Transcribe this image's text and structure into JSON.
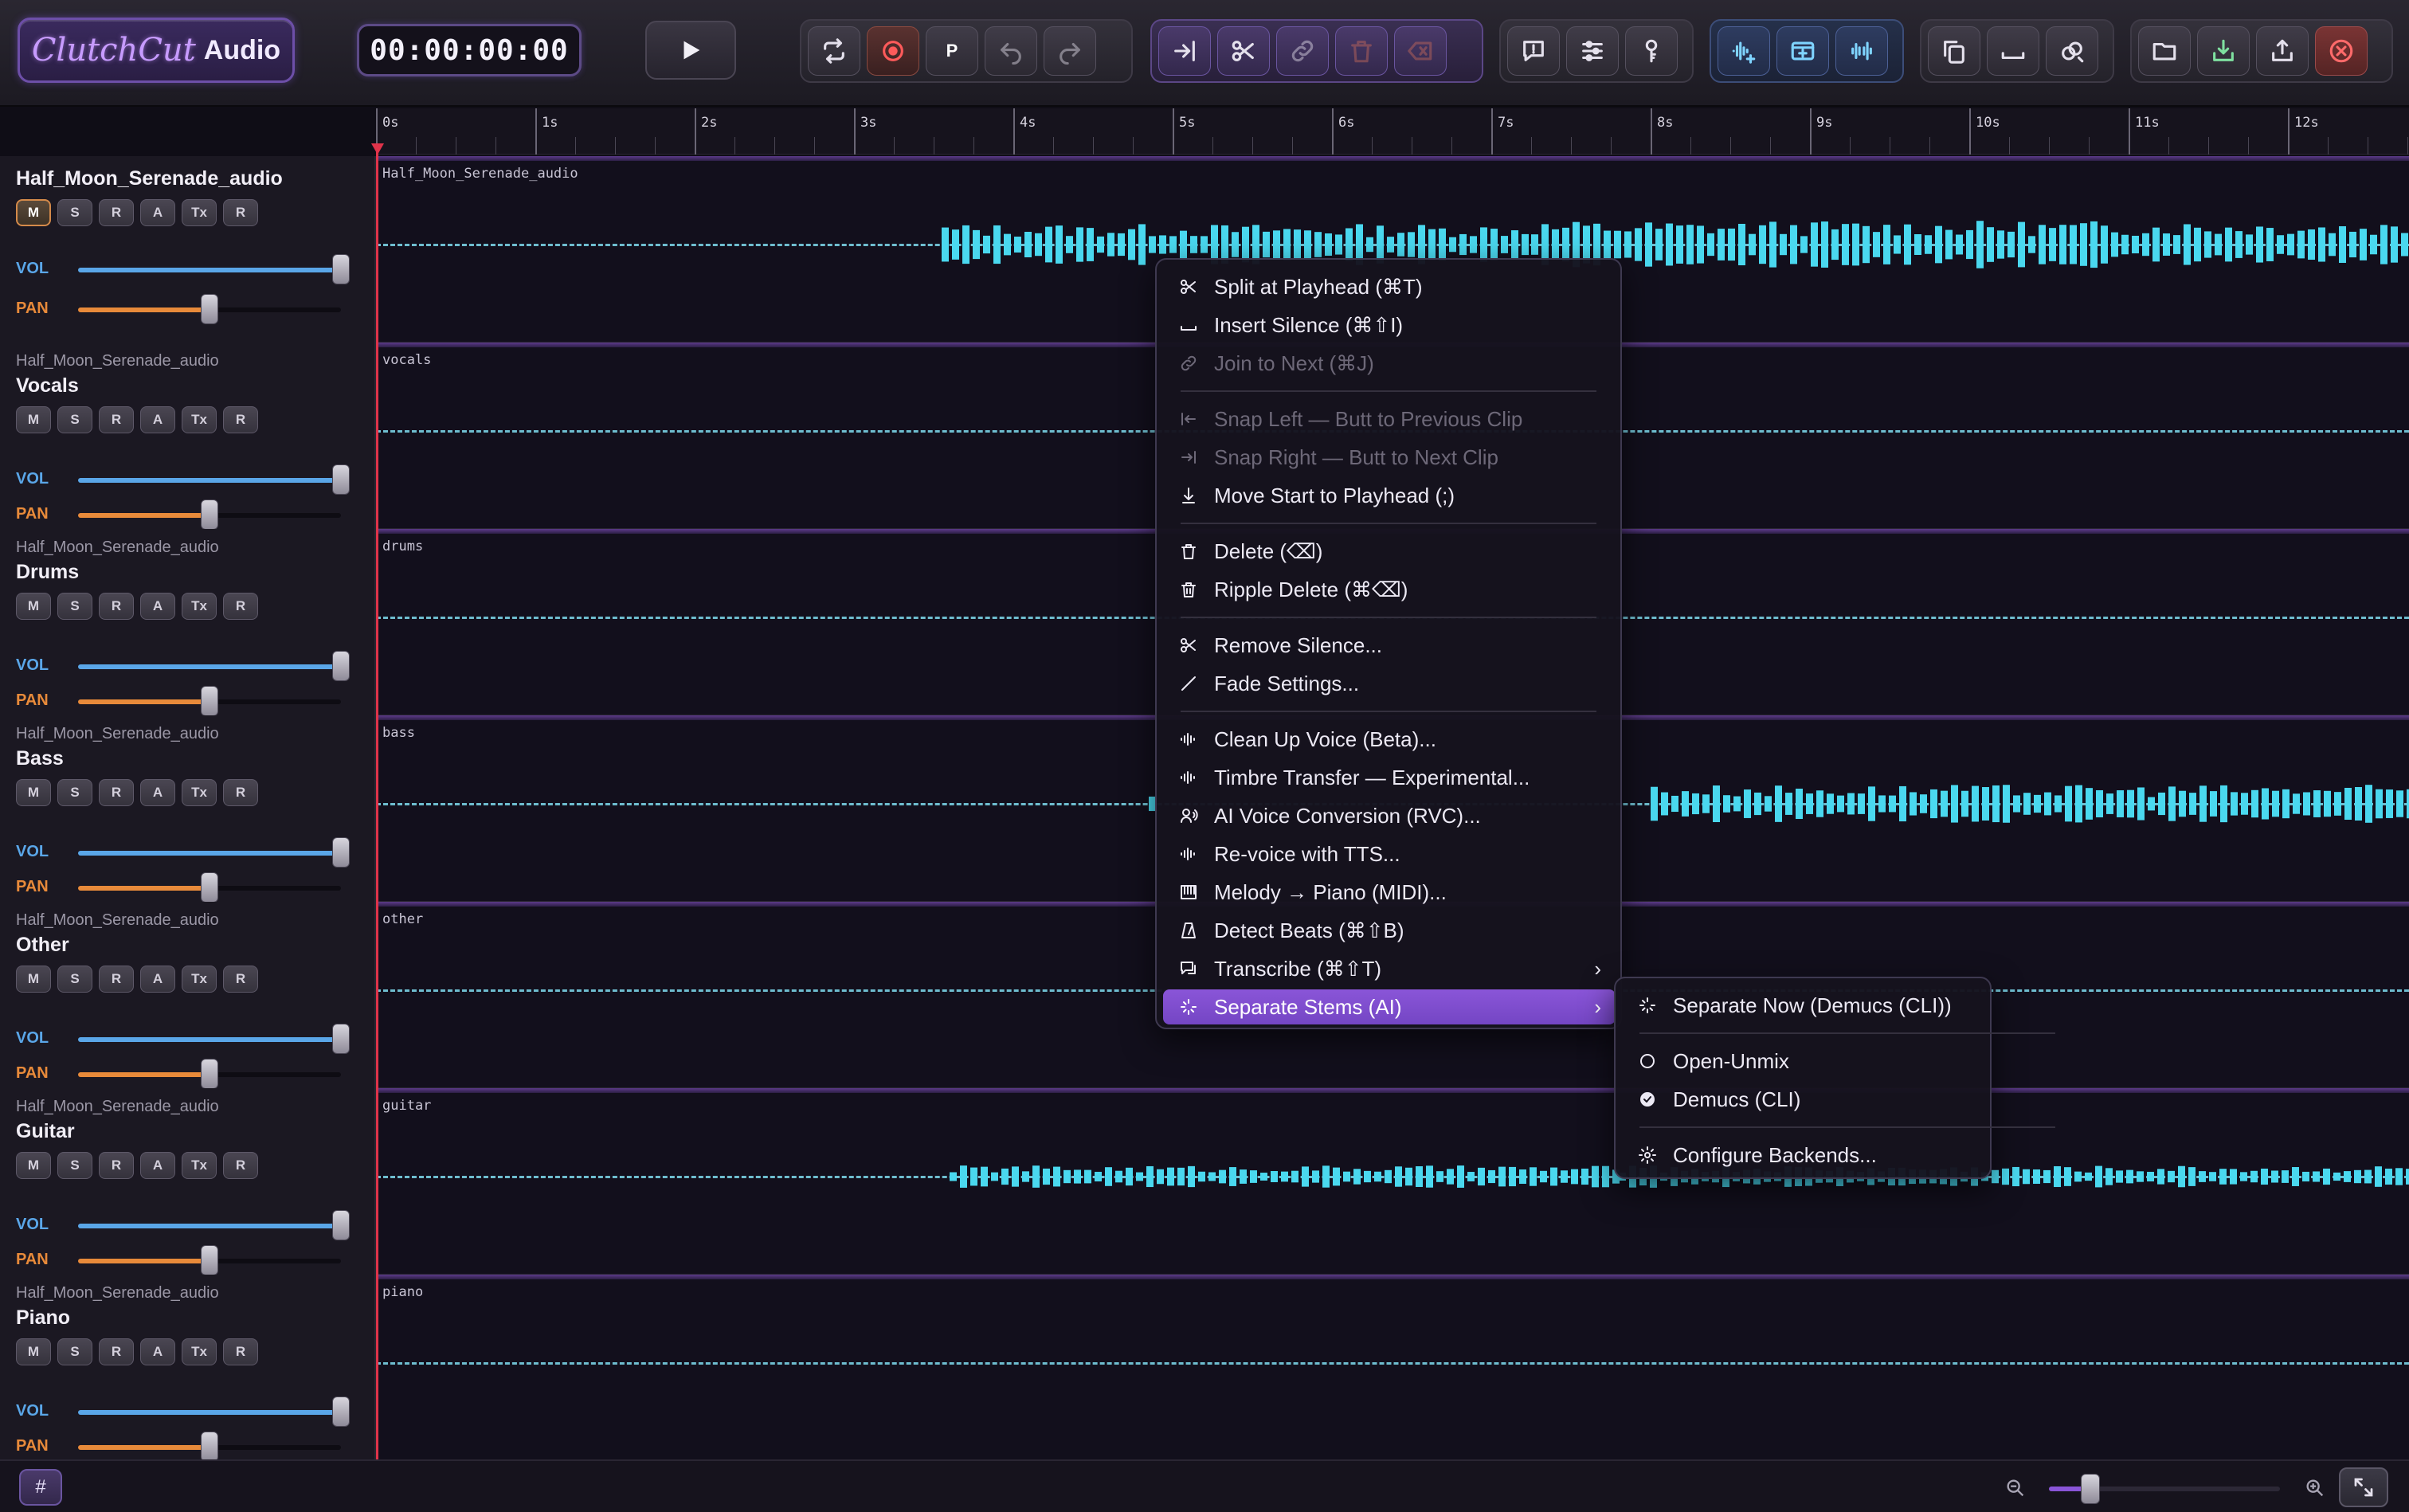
{
  "app": {
    "logo_script": "ClutchCut",
    "logo_plain": "Audio",
    "timecode": "00:00:00:00",
    "punch_label": "P"
  },
  "colors": {
    "accent": "#7b4fd6",
    "wave": "#4ad8ef",
    "record": "#e0334a",
    "vol": "#5aa6e8",
    "pan": "#e88a3a"
  },
  "toolbar_icons": [
    [
      "loop-icon",
      "record-icon",
      "punch-icon",
      "undo-icon",
      "redo-icon"
    ],
    [
      "snap-to-playhead-icon",
      "scissors-icon",
      "link-icon",
      "trash-icon",
      "erase-icon"
    ],
    [
      "comment-icon",
      "sliders-icon",
      "key-icon"
    ],
    [
      "waveform-add-icon",
      "window-add-icon",
      "waveform-split-icon"
    ],
    [
      "copy-icon",
      "silence-icon",
      "link-split-icon"
    ],
    [
      "folder-icon",
      "import-icon",
      "export-icon",
      "close-icon"
    ]
  ],
  "ruler": [
    "0s",
    "1s",
    "2s",
    "3s",
    "4s",
    "5s",
    "6s",
    "7s",
    "8s",
    "9s",
    "10s",
    "11s",
    "12s"
  ],
  "track_labels": {
    "vol": "VOL",
    "pan": "PAN",
    "buttons": [
      "M",
      "S",
      "R",
      "A",
      "Tx",
      "R"
    ]
  },
  "tracks": [
    {
      "source": "",
      "name": "Half_Moon_Serenade_audio",
      "clip": "Half_Moon_Serenade_audio",
      "vol": 1.0,
      "pan": 0.5,
      "mute_active": true
    },
    {
      "source": "Half_Moon_Serenade_audio",
      "name": "Vocals",
      "clip": "vocals",
      "vol": 1.0,
      "pan": 0.5,
      "mute_active": false
    },
    {
      "source": "Half_Moon_Serenade_audio",
      "name": "Drums",
      "clip": "drums",
      "vol": 1.0,
      "pan": 0.5,
      "mute_active": false
    },
    {
      "source": "Half_Moon_Serenade_audio",
      "name": "Bass",
      "clip": "bass",
      "vol": 1.0,
      "pan": 0.5,
      "mute_active": false
    },
    {
      "source": "Half_Moon_Serenade_audio",
      "name": "Other",
      "clip": "other",
      "vol": 1.0,
      "pan": 0.5,
      "mute_active": false
    },
    {
      "source": "Half_Moon_Serenade_audio",
      "name": "Guitar",
      "clip": "guitar",
      "vol": 1.0,
      "pan": 0.5,
      "mute_active": false
    },
    {
      "source": "Half_Moon_Serenade_audio",
      "name": "Piano",
      "clip": "piano",
      "vol": 1.0,
      "pan": 0.5,
      "mute_active": false
    }
  ],
  "context_menu": [
    {
      "label": "Split at Playhead  (⌘T)",
      "icon": "scissors",
      "disabled": false
    },
    {
      "label": "Insert Silence  (⌘⇧I)",
      "icon": "silence",
      "disabled": false
    },
    {
      "label": "Join to Next  (⌘J)",
      "icon": "link",
      "disabled": true
    },
    {
      "sep": true
    },
    {
      "label": "Snap Left — Butt to Previous Clip",
      "icon": "snap-left",
      "disabled": true
    },
    {
      "label": "Snap Right — Butt to Next Clip",
      "icon": "snap-right",
      "disabled": true
    },
    {
      "label": "Move Start to Playhead  (;)",
      "icon": "move-down",
      "disabled": false
    },
    {
      "sep": true
    },
    {
      "label": "Delete  (⌫)",
      "icon": "trash",
      "disabled": false
    },
    {
      "label": "Ripple Delete  (⌘⌫)",
      "icon": "trash-ripple",
      "disabled": false
    },
    {
      "sep": true
    },
    {
      "label": "Remove Silence...",
      "icon": "scissors",
      "disabled": false
    },
    {
      "label": "Fade Settings...",
      "icon": "fade",
      "disabled": false
    },
    {
      "sep": true
    },
    {
      "label": "Clean Up Voice (Beta)...",
      "icon": "wave",
      "disabled": false
    },
    {
      "label": "Timbre Transfer — Experimental...",
      "icon": "wave",
      "disabled": false
    },
    {
      "label": "AI Voice Conversion (RVC)...",
      "icon": "voice",
      "disabled": false
    },
    {
      "label": "Re-voice with TTS...",
      "icon": "wave",
      "disabled": false
    },
    {
      "label": "Melody → Piano (MIDI)...",
      "icon": "piano",
      "disabled": false
    },
    {
      "label": "Detect Beats  (⌘⇧B)",
      "icon": "metronome",
      "disabled": false
    },
    {
      "label": "Transcribe  (⌘⇧T)",
      "icon": "chat",
      "disabled": false,
      "submenu": true
    },
    {
      "label": "Separate Stems (AI)",
      "icon": "sparkle",
      "disabled": false,
      "submenu": true,
      "highlight": true
    }
  ],
  "submenu": [
    {
      "label": "Separate Now  (Demucs (CLI))",
      "icon": "sparkle"
    },
    {
      "sep": true
    },
    {
      "label": "Open-Unmix",
      "icon": "radio-off"
    },
    {
      "label": "Demucs (CLI)",
      "icon": "radio-on"
    },
    {
      "sep": true
    },
    {
      "label": "Configure Backends...",
      "icon": "gear"
    }
  ],
  "bottom": {
    "grid_icon": "#",
    "zoom": 0.18
  }
}
